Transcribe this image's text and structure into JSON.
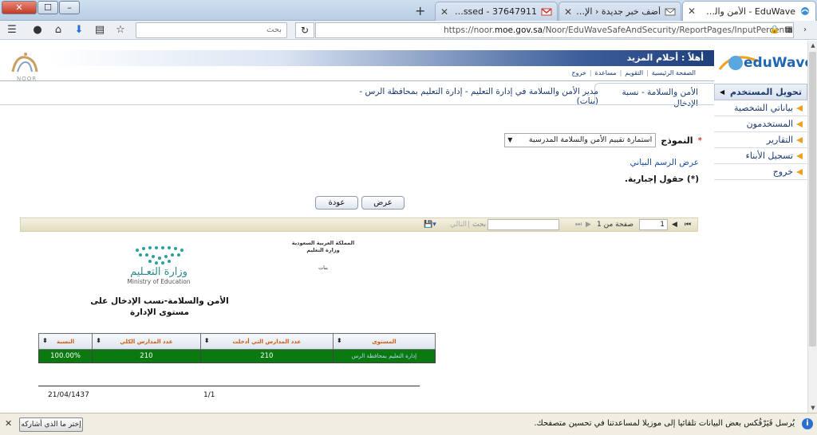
{
  "browser": {
    "tabs": [
      {
        "title": "EduWave - الأمن والسلامة - نس...",
        "active": true
      },
      {
        "title": "أضف خبر جديدة ‹ الإدارة ال...",
        "active": false
      },
      {
        "title": "37647911 - safety@alrassed...",
        "active": false
      }
    ],
    "search_placeholder": "بحث",
    "url_prefix": "https://noor.",
    "url_domain": "moe.gov.sa",
    "url_path": "/Noor/EduWaveSafeAndSecurity/ReportPages/InputPercentageReport.aspx"
  },
  "header": {
    "welcome": "أهلاً : أحلام المزيد",
    "links": [
      "الصفحة الرئيسية",
      "التقويم",
      "مساعدة",
      "خروج"
    ],
    "noor_text": "NOOR",
    "edu_logo": "eduWave"
  },
  "sidebar": {
    "title": "تحويل المستخدم",
    "items": [
      "بياناتي الشخصية",
      "المستخدمون",
      "التقارير",
      "تسجيل الأبناء",
      "خروج"
    ]
  },
  "breadcrumb": {
    "title": "الأمن والسلامة - نسبة الإدخال",
    "path": "مدير الأمن والسلامة في إدارة التعليم - إدارة التعليم بمحافظة الرس - (بنات)"
  },
  "form": {
    "label": "النموذج",
    "required_mark": "*",
    "selected": "استمارة تقييم الأمن والسلامة المدرسية",
    "chart_link": "عرض الرسم البياني",
    "required_note": "(*) حقول إجبارية.",
    "show_button": "عرض",
    "back_button": "عودة"
  },
  "report_toolbar": {
    "page_value": "1",
    "page_of": "صفحة من 1",
    "find_label": "بحث",
    "next_label": "التالي"
  },
  "report": {
    "logo_ar": "وزارة التعـليم",
    "logo_en": "Ministry of Education",
    "kingdom_line1": "المملكة العربية السعودية",
    "kingdom_line2": "وزارة التعليم",
    "girls": "بنات",
    "title": "الأمن والسلامة-نسب الإدخال على مستوى الإدارة",
    "columns": [
      "المستوى",
      "عدد المدارس التي أدخلت",
      "عدد المدارس الكلي",
      "النسبة"
    ],
    "rows": [
      [
        "إدارة التعليم بمحافظة الرس",
        "210",
        "210",
        "100.00%"
      ]
    ],
    "date": "21/04/1437",
    "page": "1/1"
  },
  "notification": {
    "text": "يُرسل فَيَرْفُكس بعض البيانات تلقائيا إلى موزيلا لمساعدتنا في تحسين متصفحك.",
    "button": "إختر ما الذي أشاركه"
  },
  "colors": {
    "header_blue": "#1f3f7b",
    "table_green": "#0a7a10",
    "header_orange": "#d05a10"
  }
}
